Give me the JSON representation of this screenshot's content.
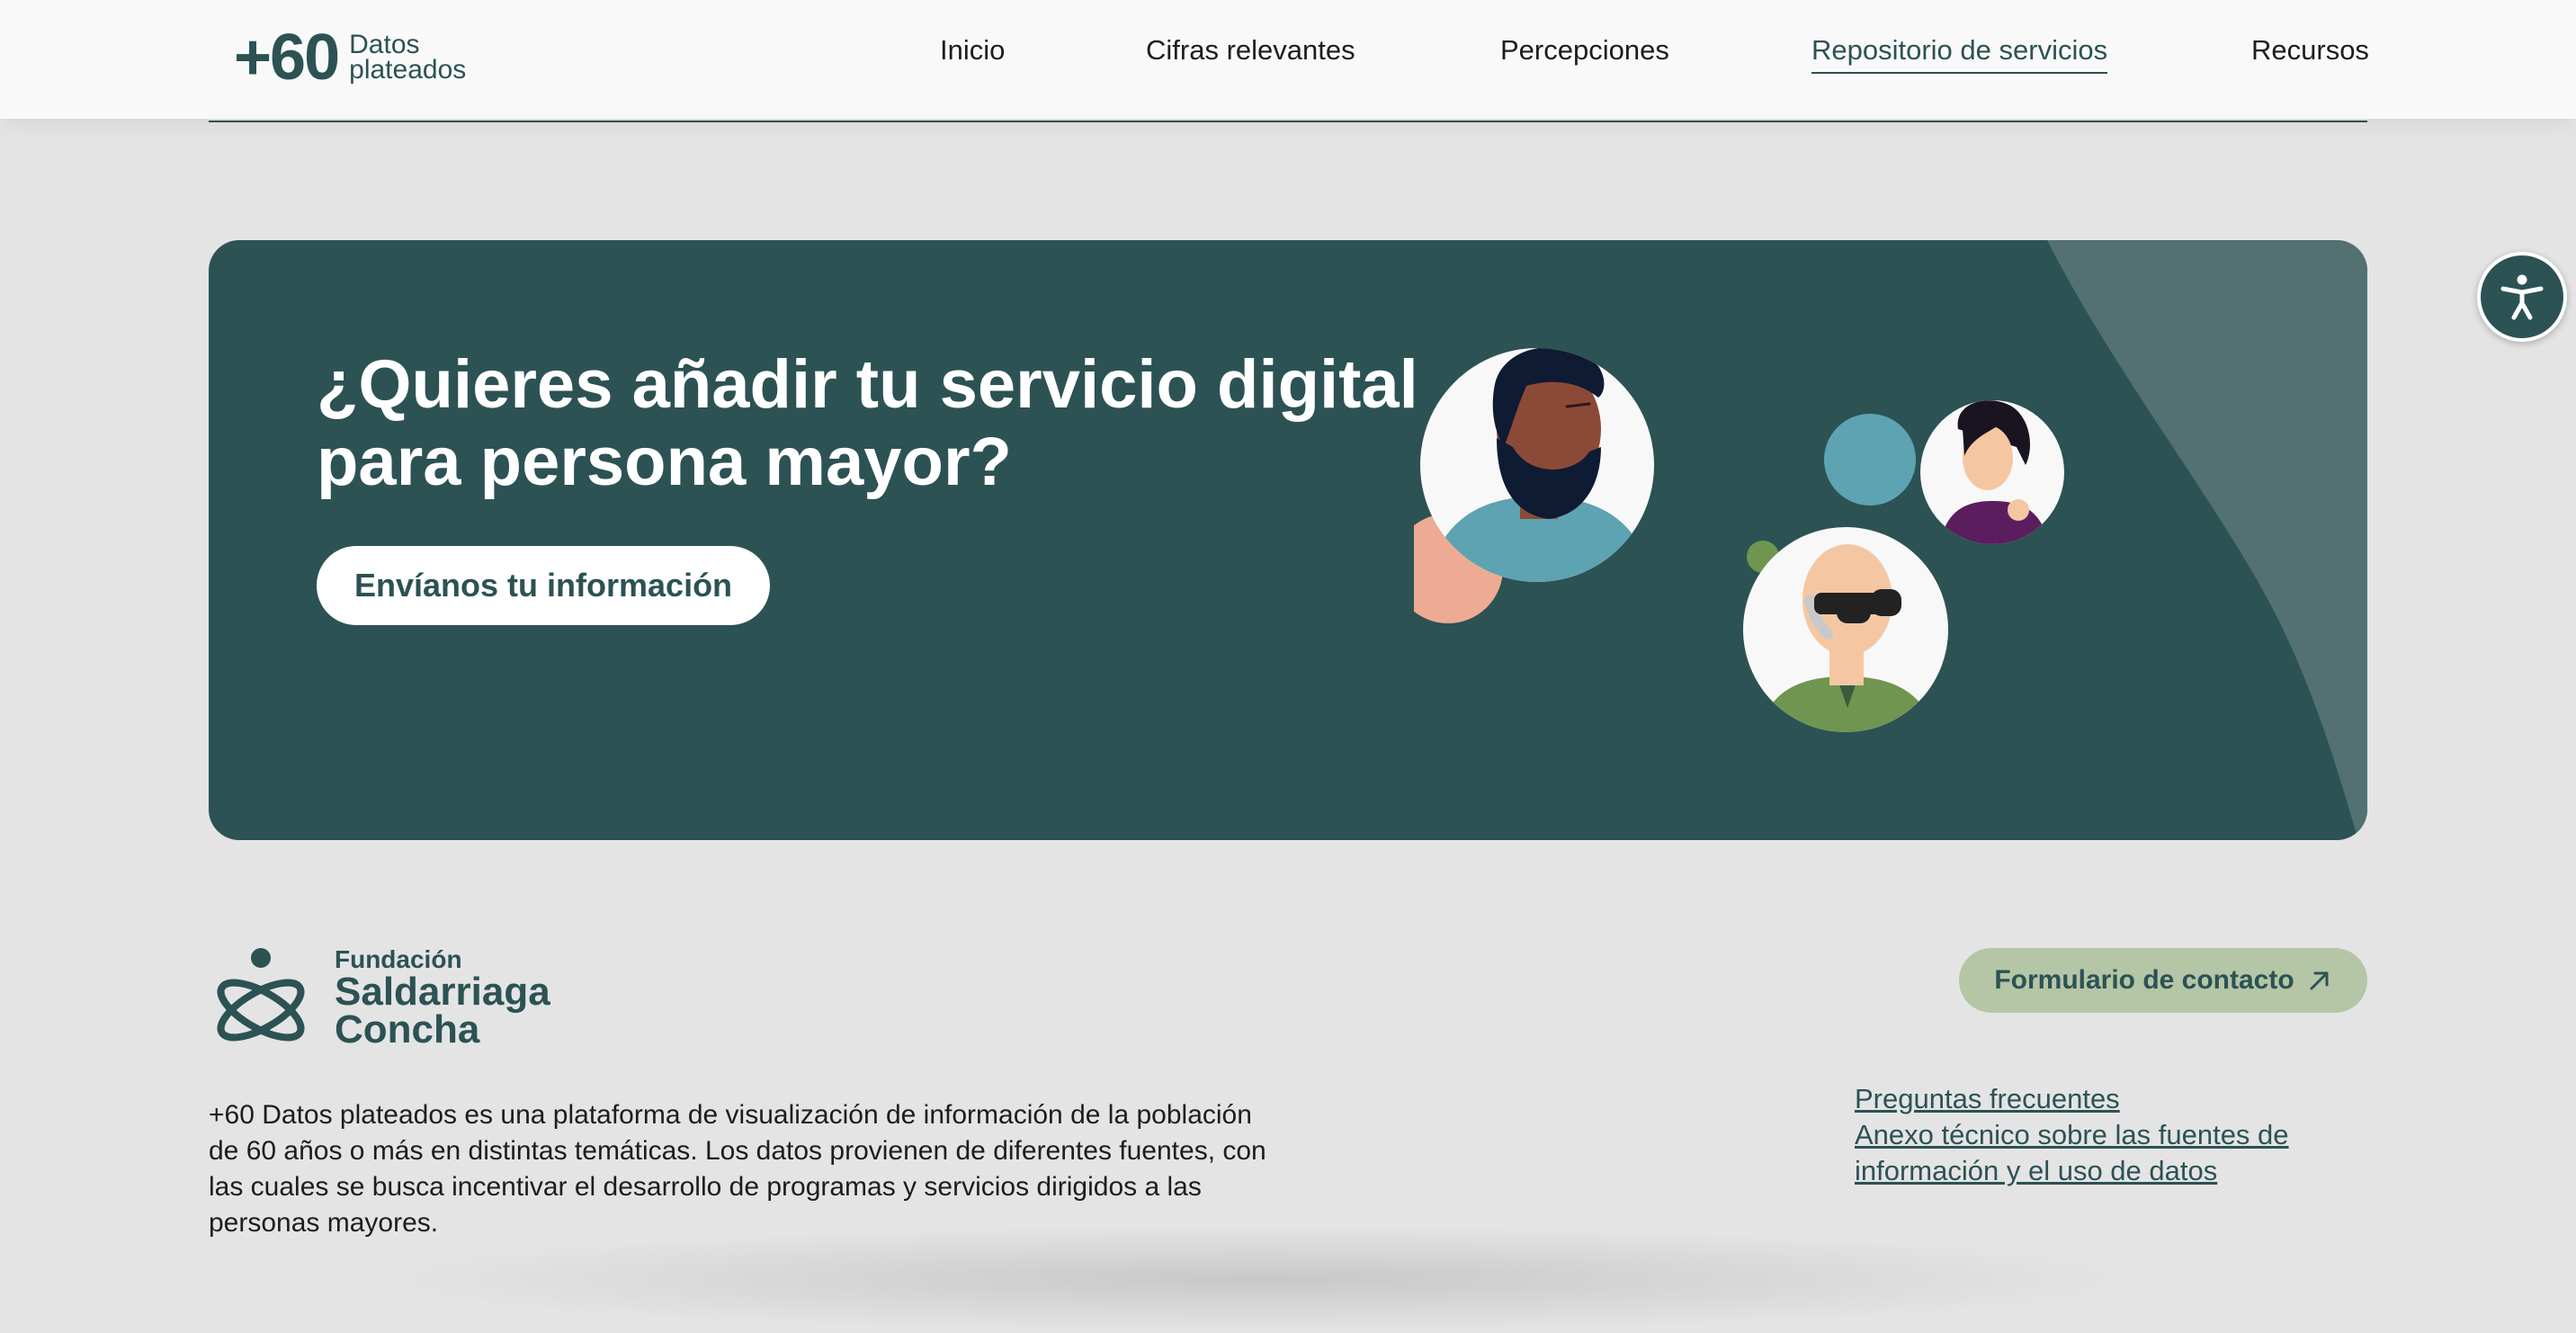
{
  "header": {
    "logo_big": "+60",
    "logo_small_line1": "Datos",
    "logo_small_line2": "plateados",
    "nav": [
      {
        "label": "Inicio"
      },
      {
        "label": "Cifras relevantes"
      },
      {
        "label": "Percepciones"
      },
      {
        "label": "Repositorio de servicios",
        "active": true
      },
      {
        "label": "Recursos"
      }
    ]
  },
  "accessibility": {
    "icon": "accessibility-person-icon"
  },
  "banner": {
    "title": "¿Quieres añadir tu servicio digital para persona mayor?",
    "button_label": "Envíanos tu información",
    "illustration": [
      "bearded-man-avatar",
      "woman-avatar",
      "older-man-sunglasses-avatar"
    ],
    "colors": {
      "background": "#2c5254",
      "accent_blue": "#5ea3b2",
      "accent_peach": "#eeab93",
      "accent_green": "#6f9550"
    }
  },
  "footer": {
    "org_small": "Fundación",
    "org_line1": "Saldarriaga",
    "org_line2": "Concha",
    "description": "+60 Datos plateados es una plataforma de visualización de información de la población de 60 años o más en distintas temáticas. Los datos provienen de diferentes fuentes, con las cuales se busca incentivar el desarrollo de programas y servicios dirigidos a las personas mayores.",
    "contact_label": "Formulario de contacto",
    "links": [
      {
        "label": "Preguntas frecuentes"
      },
      {
        "label": "Anexo técnico sobre las fuentes de información y el uso de datos"
      }
    ]
  },
  "colors": {
    "brand": "#2c5254",
    "page_bg": "#e4e4e4",
    "contact_bg": "#b4c6a6"
  }
}
